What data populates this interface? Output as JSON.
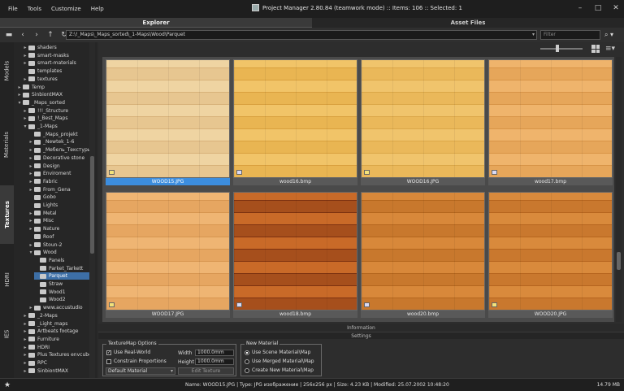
{
  "menu": [
    "File",
    "Tools",
    "Customize",
    "Help"
  ],
  "window_title": "Project Manager 2.80.84 (teamwork mode) :: Items: 106 :: Selected: 1",
  "main_tabs": {
    "explorer": "Explorer",
    "asset_files": "Asset Files"
  },
  "address": {
    "path": "Z:\\!_Maps\\_Maps_sorted\\_1-Maps\\Wood\\Parquet",
    "filter_placeholder": "Filter"
  },
  "vertical_tabs": [
    "Models",
    "Materials",
    "Textures",
    "HDRI",
    "IES"
  ],
  "tree": [
    {
      "label": "shaders",
      "indent": 1,
      "arrow": "▸"
    },
    {
      "label": "smart-masks",
      "indent": 1,
      "arrow": "▸"
    },
    {
      "label": "smart-materials",
      "indent": 1,
      "arrow": "▸"
    },
    {
      "label": "templates",
      "indent": 1,
      "arrow": ""
    },
    {
      "label": "textures",
      "indent": 1,
      "arrow": "▸"
    },
    {
      "label": "Temp",
      "indent": 0,
      "arrow": "▸"
    },
    {
      "label": "SinbiontMAX",
      "indent": 0,
      "arrow": "▸"
    },
    {
      "label": "_Maps_sorted",
      "indent": 0,
      "arrow": "▾"
    },
    {
      "label": "!!!_Structure",
      "indent": 1,
      "arrow": "▸"
    },
    {
      "label": "!_Best_Maps",
      "indent": 1,
      "arrow": "▸"
    },
    {
      "label": "_1-Maps",
      "indent": 1,
      "arrow": "▾"
    },
    {
      "label": "_Maps_projekt",
      "indent": 2,
      "arrow": ""
    },
    {
      "label": "_Newtek_1-6",
      "indent": 2,
      "arrow": "▸"
    },
    {
      "label": "_Мебель_Текстуры",
      "indent": 2,
      "arrow": "▸"
    },
    {
      "label": "Decorative stone",
      "indent": 2,
      "arrow": "▸"
    },
    {
      "label": "Design",
      "indent": 2,
      "arrow": "▸"
    },
    {
      "label": "Enviroment",
      "indent": 2,
      "arrow": "▸"
    },
    {
      "label": "Fabric",
      "indent": 2,
      "arrow": "▸"
    },
    {
      "label": "From_Gena",
      "indent": 2,
      "arrow": "▸"
    },
    {
      "label": "Gobo",
      "indent": 2,
      "arrow": ""
    },
    {
      "label": "Lights",
      "indent": 2,
      "arrow": ""
    },
    {
      "label": "Metal",
      "indent": 2,
      "arrow": "▸"
    },
    {
      "label": "Misc",
      "indent": 2,
      "arrow": "▸"
    },
    {
      "label": "Nature",
      "indent": 2,
      "arrow": "▸"
    },
    {
      "label": "Roof",
      "indent": 2,
      "arrow": ""
    },
    {
      "label": "Stoun-2",
      "indent": 2,
      "arrow": "▸"
    },
    {
      "label": "Wood",
      "indent": 2,
      "arrow": "▾"
    },
    {
      "label": "Panels",
      "indent": 3,
      "arrow": ""
    },
    {
      "label": "Parket_Tarkett",
      "indent": 3,
      "arrow": ""
    },
    {
      "label": "Parquet",
      "indent": 3,
      "arrow": "",
      "selected": true
    },
    {
      "label": "Straw",
      "indent": 3,
      "arrow": ""
    },
    {
      "label": "Wood1",
      "indent": 3,
      "arrow": ""
    },
    {
      "label": "Wood2",
      "indent": 3,
      "arrow": ""
    },
    {
      "label": "www.accustudio",
      "indent": 2,
      "arrow": "▸"
    },
    {
      "label": "_2-Maps",
      "indent": 1,
      "arrow": "▸"
    },
    {
      "label": "_Light_maps",
      "indent": 1,
      "arrow": "▸"
    },
    {
      "label": "Artbeats footage",
      "indent": 1,
      "arrow": "▸"
    },
    {
      "label": "Furniture",
      "indent": 1,
      "arrow": "▸"
    },
    {
      "label": "HDRI",
      "indent": 1,
      "arrow": "▸"
    },
    {
      "label": "Plus Textures envcube",
      "indent": 1,
      "arrow": "▸"
    },
    {
      "label": "RPC",
      "indent": 1,
      "arrow": "▸"
    },
    {
      "label": "SinbiontMAX",
      "indent": 1,
      "arrow": "▸"
    }
  ],
  "thumbnails": [
    {
      "name": "WOOD15.JPG",
      "badge": "jpg",
      "selected": true,
      "colors": [
        "#e7c690",
        "#d8b27a",
        "#efd4a2"
      ]
    },
    {
      "name": "wood16.bmp",
      "badge": "bmp",
      "selected": false,
      "colors": [
        "#e9b552",
        "#d9a03e",
        "#f1c468"
      ]
    },
    {
      "name": "WOOD16.JPG",
      "badge": "jpg",
      "selected": false,
      "colors": [
        "#eab85a",
        "#dba748",
        "#f0c46c"
      ]
    },
    {
      "name": "wood17.bmp",
      "badge": "bmp",
      "selected": false,
      "colors": [
        "#e6a65a",
        "#d89447",
        "#efb46c"
      ]
    },
    {
      "name": "WOOD17.JPG",
      "badge": "jpg",
      "selected": false,
      "colors": [
        "#e6a661",
        "#d79650",
        "#efb573"
      ]
    },
    {
      "name": "wood18.bmp",
      "badge": "bmp",
      "selected": false,
      "colors": [
        "#a64f1c",
        "#7d3210",
        "#c96a28"
      ]
    },
    {
      "name": "wood20.bmp",
      "badge": "bmp",
      "selected": false,
      "colors": [
        "#c8782d",
        "#b4661e",
        "#d8883a"
      ]
    },
    {
      "name": "WOOD20.JPG",
      "badge": "jpg",
      "selected": false,
      "colors": [
        "#c9782e",
        "#b6651f",
        "#d98a3c"
      ]
    }
  ],
  "bars": {
    "information": "Information",
    "settings": "Settings"
  },
  "texturemap_options": {
    "title": "TextureMap Options",
    "use_real_world": "Use Real-World",
    "use_real_world_checked": true,
    "constrain_proportions": "Constrain Proportions",
    "constrain_checked": false,
    "width_label": "Width",
    "width_value": "1000.0mm",
    "height_label": "Height",
    "height_value": "1000.0mm",
    "material_select": "Default Material",
    "edit_texture": "Edit Texture"
  },
  "new_material": {
    "title": "New Material",
    "options": [
      "Use Scene Material\\Map",
      "Use Merged Material\\Map",
      "Create New Material\\Map"
    ],
    "selected_index": 0
  },
  "status": {
    "text": "Name: WOOD15.JPG | Type: JPG изображение | 256x256 px | Size: 4.23 KB | Modified: 25.07.2002 10:48:20",
    "memory": "14.79 MB"
  }
}
